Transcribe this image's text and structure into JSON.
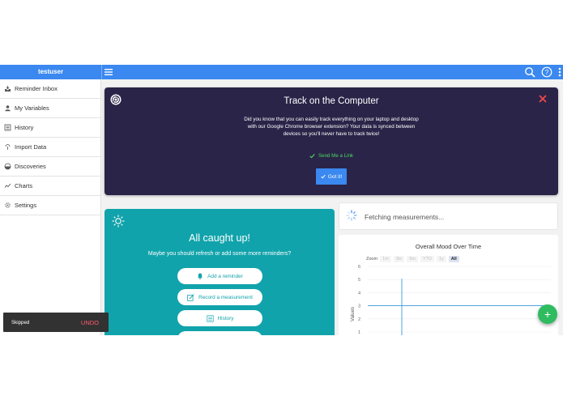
{
  "topbar": {
    "username": "testuser",
    "icons": [
      "menu-icon",
      "search-icon",
      "help-icon",
      "more-vert-icon"
    ],
    "color": "#3a88f0"
  },
  "sidebar": {
    "items": [
      {
        "label": "Reminder Inbox",
        "icon": "inbox-icon"
      },
      {
        "label": "My Variables",
        "icon": "person-icon"
      },
      {
        "label": "History",
        "icon": "list-icon"
      },
      {
        "label": "Import Data",
        "icon": "import-icon"
      },
      {
        "label": "Discoveries",
        "icon": "discovery-icon"
      },
      {
        "label": "Charts",
        "icon": "chart-icon"
      },
      {
        "label": "Settings",
        "icon": "gear-icon"
      }
    ]
  },
  "promo": {
    "title": "Track on the Computer",
    "body": "Did you know that you can easily track everything on your laptop and desktop with our Google Chrome browser extension? Your data is synced between devices so you'll never have to track twice!",
    "send_link": "Send Me a Link",
    "got_it": "Got it!",
    "background": "#2a2448",
    "link_color": "#4cd964"
  },
  "reminders": {
    "heading": "All caught up!",
    "subtext": "Maybe you should refresh or add some more reminders?",
    "buttons": [
      {
        "label": "Add a reminder",
        "icon": "bell-icon"
      },
      {
        "label": "Record a measurement",
        "icon": "edit-icon"
      },
      {
        "label": "History",
        "icon": "list-icon"
      },
      {
        "label": "",
        "icon": "bell-icon"
      }
    ],
    "background": "#11a3ab"
  },
  "fetching": {
    "text": "Fetching measurements..."
  },
  "chart": {
    "zoom_label": "Zoom",
    "zoom_options": [
      "1m",
      "3m",
      "6m",
      "YTD",
      "1y",
      "All"
    ],
    "zoom_selected": "All"
  },
  "chart_data": {
    "type": "line",
    "title": "Overall Mood Over Time",
    "xlabel": "",
    "ylabel": "Values",
    "ylim": [
      1,
      6
    ],
    "yticks": [
      1,
      2,
      3,
      4,
      5,
      6
    ],
    "series": [
      {
        "values": [
          3,
          3
        ]
      }
    ],
    "grid": true,
    "legend": "none"
  },
  "fab": {
    "label": "+"
  },
  "snackbar": {
    "text": "Skipped",
    "action": "UNDO",
    "action_color": "#ff5a6e"
  }
}
